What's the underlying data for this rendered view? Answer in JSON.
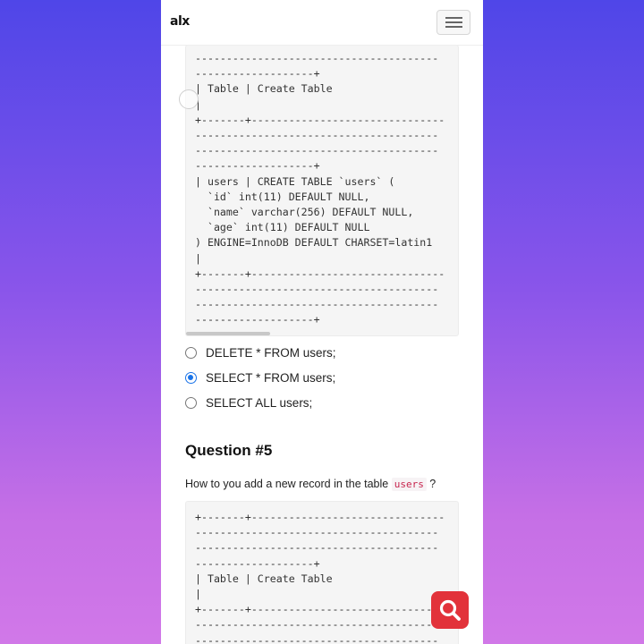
{
  "header": {
    "logo_text": "alx",
    "menu_icon": "hamburger-icon"
  },
  "code_block_top": {
    "text": "---------------------------------------\n-------------------+\n| Table | Create Table\n|\n+-------+-------------------------------\n---------------------------------------\n---------------------------------------\n-------------------+\n| users | CREATE TABLE `users` (\n  `id` int(11) DEFAULT NULL,\n  `name` varchar(256) DEFAULT NULL,\n  `age` int(11) DEFAULT NULL\n) ENGINE=InnoDB DEFAULT CHARSET=latin1\n|\n+-------+-------------------------------\n---------------------------------------\n---------------------------------------\n-------------------+"
  },
  "options": [
    {
      "label": "DELETE * FROM users;",
      "checked": false
    },
    {
      "label": "SELECT * FROM users;",
      "checked": true
    },
    {
      "label": "SELECT ALL users;",
      "checked": false
    }
  ],
  "question": {
    "title": "Question #5",
    "text_before": "How to you add a new record in the table ",
    "inline_code": "users",
    "text_after": " ?"
  },
  "code_block_bottom": {
    "text": "+-------+-------------------------------\n---------------------------------------\n---------------------------------------\n-------------------+\n| Table | Create Table\n|\n+-------+-------------------------------\n---------------------------------------\n---------------------------------------"
  },
  "search_button": {
    "icon": "search-icon",
    "color": "#e2323a"
  },
  "colors": {
    "radio_checked": "#1a73e8",
    "inline_code": "#c7254e"
  }
}
